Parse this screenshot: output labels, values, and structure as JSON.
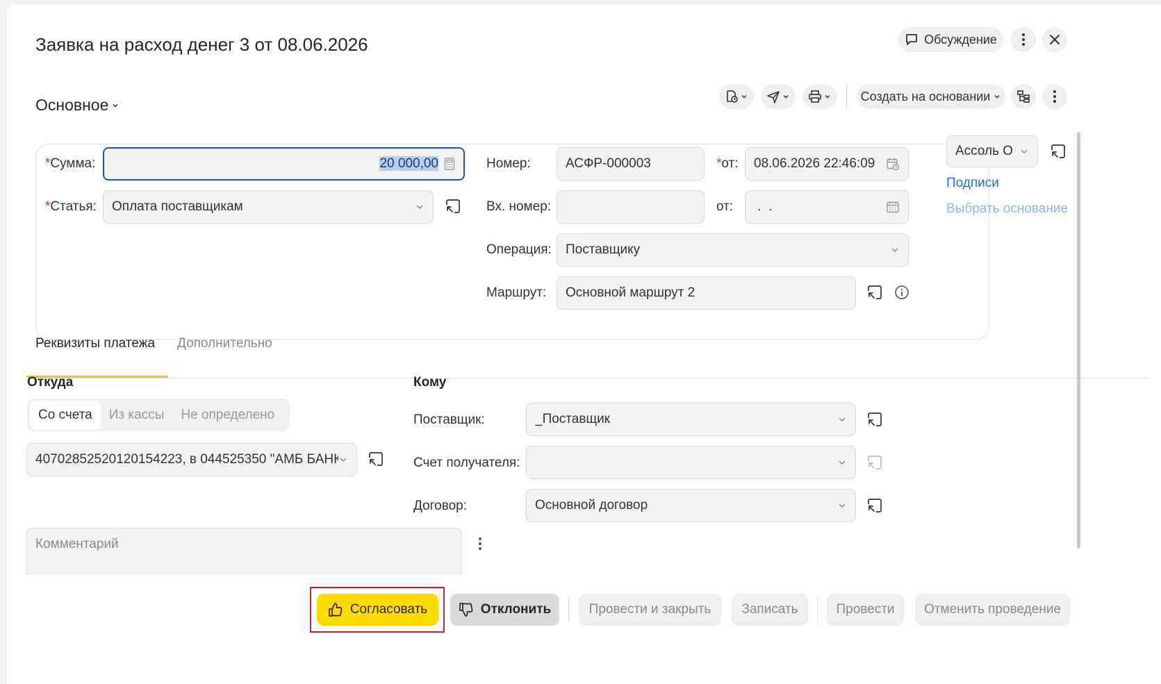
{
  "window": {
    "title": "Заявка на расход денег 3 от 08.06.2026",
    "discussion_label": "Обсуждение"
  },
  "header": {
    "section_label": "Основное",
    "create_based_on_label": "Создать на основании"
  },
  "form": {
    "sum": {
      "label": "Сумма:",
      "value": "20 000,00"
    },
    "article": {
      "label": "Статья:",
      "value": "Оплата поставщикам"
    },
    "number": {
      "label": "Номер:",
      "value": "АСФР-000003"
    },
    "date": {
      "label": "от:",
      "value": "08.06.2026 22:46:09"
    },
    "in_number": {
      "label": "Вх. номер:",
      "value": ""
    },
    "in_date": {
      "label": "от:",
      "value": " .  ."
    },
    "operation": {
      "label": "Операция:",
      "value": "Поставщику"
    },
    "route": {
      "label": "Маршрут:",
      "value": "Основной маршрут 2"
    },
    "required_mark": "*"
  },
  "right_panel": {
    "org_value": "Ассоль О",
    "signatures_link": "Подписи",
    "choose_basis_link": "Выбрать основание"
  },
  "tabs": [
    {
      "label": "Реквизиты платежа",
      "active": true
    },
    {
      "label": "Дополнительно",
      "active": false
    }
  ],
  "from_section": {
    "heading": "Откуда",
    "options": [
      "Со счета",
      "Из кассы",
      "Не определено"
    ],
    "selected": "Со счета",
    "account_value": "40702852520120154223, в 044525350 \"АМБ БАНК"
  },
  "to_section": {
    "heading": "Кому",
    "supplier": {
      "label": "Поставщик:",
      "value": "_Поставщик"
    },
    "recipient_account": {
      "label": "Счет получателя:",
      "value": ""
    },
    "contract": {
      "label": "Договор:",
      "value": "Основной договор"
    }
  },
  "comment": {
    "placeholder": "Комментарий"
  },
  "footer": {
    "approve": "Согласовать",
    "reject": "Отклонить",
    "post_close": "Провести и закрыть",
    "save": "Записать",
    "post": "Провести",
    "unpost": "Отменить проведение"
  },
  "colors": {
    "accent_yellow": "#ffdb00",
    "link_blue": "#1b73d8",
    "required_red": "#e0302c",
    "focus_border": "#1f5b99",
    "highlight_red": "#c1272d"
  }
}
